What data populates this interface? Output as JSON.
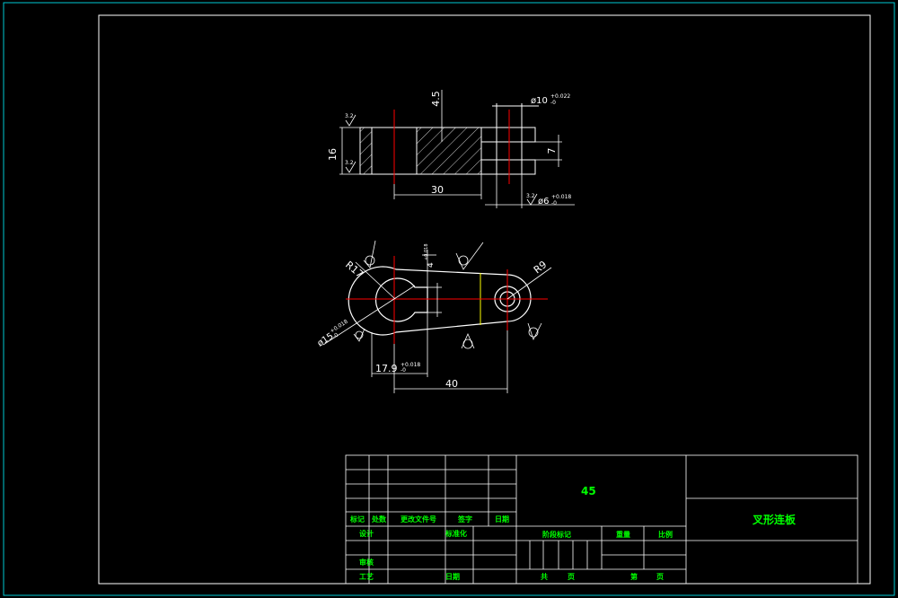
{
  "colors": {
    "frame": "#00c8d2",
    "outline": "#ffffff",
    "center_line": "#ff0000",
    "dimension": "#ffffff",
    "hatch": "#ffffff",
    "title_block_text": "#00ff00",
    "yellow_line": "#ffff00"
  },
  "top_view": {
    "dim_height": "16",
    "dim_step": "4.5",
    "dim_hole_top": "ø10",
    "dim_hole_top_tol": "+0.022",
    "dim_hole_top_tol_low": "-0",
    "dim_slot": "7",
    "dim_length": "30",
    "dim_hole_bottom": "ø6",
    "dim_hole_bottom_tol": "+0.018",
    "dim_hole_bottom_tol_low": "-0",
    "rough_1": "3.2",
    "rough_2": "3.2",
    "rough_3": "3.2"
  },
  "front_view": {
    "radius_left": "R17",
    "radius_right": "R9",
    "dia_bore": "ø15",
    "dia_bore_tol": "+0.018",
    "dia_bore_tol_low": "-0",
    "keyway": "17.9",
    "keyway_tol": "+0.018",
    "keyway_tol_low": "-0",
    "keyway_top": "4",
    "keyway_top_tol": "+0.018",
    "center_distance": "40"
  },
  "title_block": {
    "material": "45",
    "part_name": "叉形连板",
    "labels": {
      "mark": "标记",
      "count": "处数",
      "change_doc": "更改文件号",
      "signature": "签字",
      "date": "日期",
      "design": "设计",
      "standardize": "标准化",
      "check": "审核",
      "process": "工艺",
      "date2": "日期",
      "stage_mark": "阶段标记",
      "weight": "重量",
      "scale": "比例",
      "sheets_total": "共",
      "sheet_unit": "页",
      "sheet_no": "第",
      "sheet_unit2": "页"
    }
  }
}
